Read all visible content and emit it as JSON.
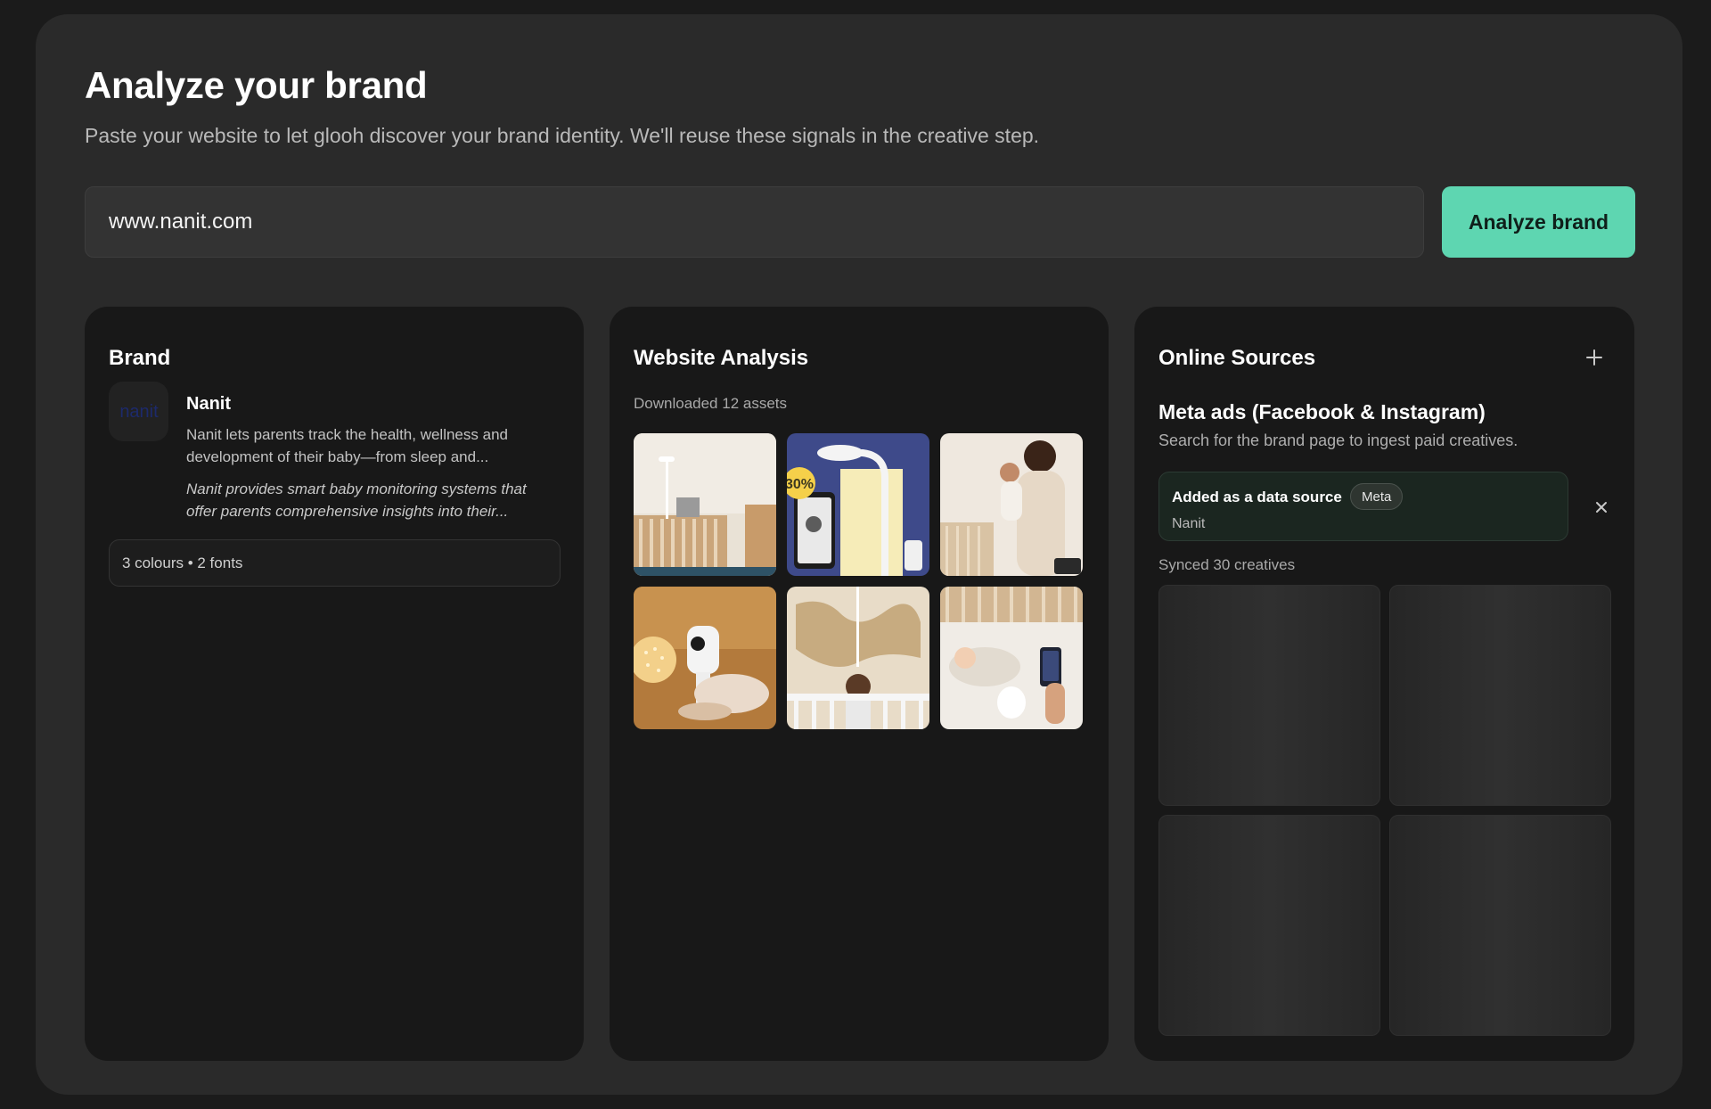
{
  "header": {
    "title": "Analyze your brand",
    "subtitle": "Paste your website to let glooh discover your brand identity. We'll reuse these signals in the creative step."
  },
  "url_input": {
    "value": "www.nanit.com",
    "placeholder": ""
  },
  "analyze_button": {
    "label": "Analyze brand"
  },
  "colors": {
    "accent": "#5ed6b1",
    "panel_bg": "#181818",
    "shell_bg": "#2a2a2a",
    "source_card_bg": "#1b2620"
  },
  "brand_panel": {
    "title": "Brand",
    "logo_text": "nanit",
    "name": "Nanit",
    "description": "Nanit lets parents track the health, wellness and development of their baby—from sleep and...",
    "summary": "Nanit provides smart baby monitoring systems that offer parents comprehensive insights into their...",
    "stats": "3 colours • 2 fonts"
  },
  "website_panel": {
    "title": "Website Analysis",
    "assets_count": "Downloaded 12 assets",
    "assets": [
      {
        "label": "nursery crib with camera stand"
      },
      {
        "label": "camera with phone app and 30% badge",
        "badge": "30%"
      },
      {
        "label": "parent holding baby by crib"
      },
      {
        "label": "camera and night light on sofa"
      },
      {
        "label": "baby standing in crib with world map"
      },
      {
        "label": "baby sleeping with phone app"
      }
    ]
  },
  "sources_panel": {
    "title": "Online Sources",
    "add_icon": "plus-icon",
    "source_title": "Meta ads (Facebook & Instagram)",
    "source_subtitle": "Search for the brand page to ingest paid creatives.",
    "source_card": {
      "label": "Added as a data source",
      "badge": "Meta",
      "name": "Nanit"
    },
    "remove_icon": "close-icon",
    "synced_count": "Synced 30 creatives",
    "creatives": [
      {},
      {},
      {},
      {}
    ]
  }
}
